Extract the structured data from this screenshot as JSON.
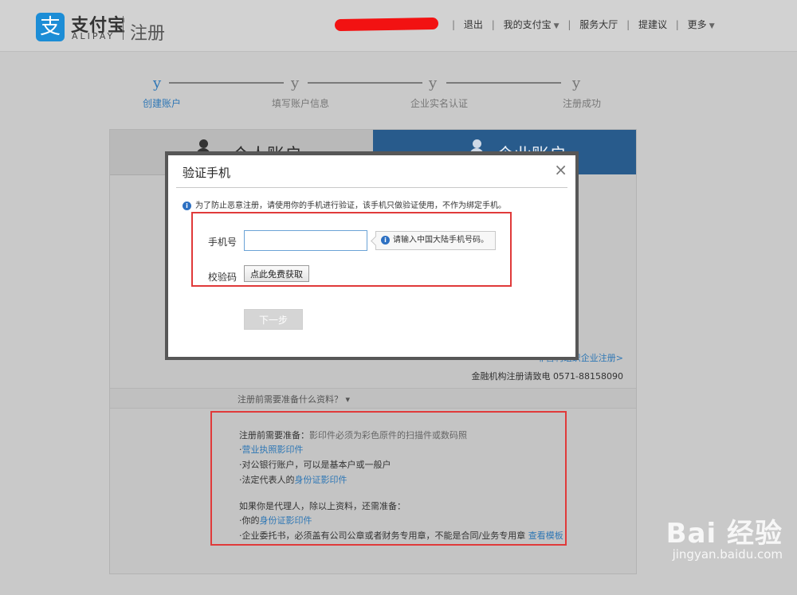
{
  "header": {
    "logo_glyph": "支",
    "logo_cn": "支付宝",
    "logo_en": "ALIPAY",
    "section": "注册",
    "nav": [
      {
        "label": "退出",
        "dropdown": false
      },
      {
        "label": "我的支付宝",
        "dropdown": true
      },
      {
        "label": "服务大厅",
        "dropdown": false
      },
      {
        "label": "提建议",
        "dropdown": false
      },
      {
        "label": "更多",
        "dropdown": true
      }
    ]
  },
  "steps": [
    {
      "marker": "y",
      "label": "创建账户",
      "active": true
    },
    {
      "marker": "y",
      "label": "填写账户信息",
      "active": false
    },
    {
      "marker": "y",
      "label": "企业实名认证",
      "active": false
    },
    {
      "marker": "y",
      "label": "注册成功",
      "active": false
    }
  ],
  "tabs": {
    "personal": "个人账户",
    "enterprise": "企业账户"
  },
  "panel": {
    "org_link": "非营利组织企业注册>",
    "finance": "金融机构注册请致电  0571-88158090",
    "prep_toggle": "注册前需要准备什么资料？",
    "requirements": {
      "heading": "注册前需要准备：",
      "heading_note": "影印件必须为彩色原件的扫描件或数码照",
      "items": [
        {
          "pre": "·",
          "text": "",
          "link": "营业执照影印件"
        },
        {
          "pre": "·",
          "text": "对公银行账户，可以是基本户或一般户",
          "link": ""
        },
        {
          "pre": "·",
          "text": "法定代表人的",
          "link": "身份证影印件"
        }
      ],
      "agent_heading": "如果你是代理人，除以上资料，还需准备：",
      "agent_items": [
        {
          "pre": "·",
          "text": "你的",
          "link": "身份证影印件"
        },
        {
          "pre": "·",
          "text": "企业委托书，必须盖有公司公章或者财务专用章，不能是合同/业务专用章 ",
          "link": "查看模板"
        }
      ]
    }
  },
  "modal": {
    "title": "验证手机",
    "close": "×",
    "notice": "为了防止恶意注册，请使用你的手机进行验证，该手机只做验证使用，不作为绑定手机。",
    "phone_label": "手机号",
    "phone_value": "",
    "phone_hint": "请输入中国大陆手机号码。",
    "code_label": "校验码",
    "code_button": "点此免费获取",
    "next_button": "下一步"
  },
  "watermark": {
    "brand": "Bai 经验",
    "url": "jingyan.baidu.com"
  },
  "colors": {
    "alipay_blue": "#1c8dd6",
    "enterprise_tab": "#285b8c",
    "link": "#2f77b5",
    "highlight_red": "#e03a3a",
    "redaction": "#f21212"
  }
}
